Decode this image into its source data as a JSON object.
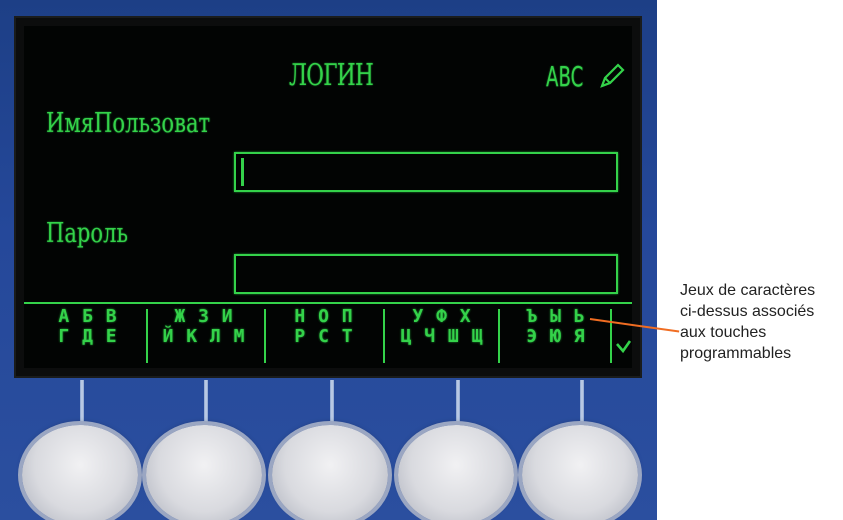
{
  "screen": {
    "title": "ЛОГИН",
    "input_mode": "ABC",
    "input_mode_icon": "pencil-icon",
    "username_label": "ИмяПользоват",
    "username_value": "",
    "password_label": "Пароль",
    "password_value": "",
    "text_color": "#34d24a",
    "background_color": "#020403"
  },
  "softkeys": [
    {
      "row1": "А Б В",
      "row2": "Г Д Е"
    },
    {
      "row1": "Ж З И",
      "row2": "Й К Л М"
    },
    {
      "row1": "Н О П",
      "row2": "Р С Т"
    },
    {
      "row1": "У Ф Х",
      "row2": "Ц Ч Ш Щ"
    },
    {
      "row1": "Ъ Ы Ь",
      "row2": "Э Ю Я"
    }
  ],
  "softkey_more_icon": "chevron-down-icon",
  "caption": {
    "line1": "Jeux de caractères",
    "line2": "ci-dessus associés",
    "line3": "aux touches",
    "line4": "programmables",
    "callout_color": "#f06d22"
  },
  "device_color": "#25489a"
}
